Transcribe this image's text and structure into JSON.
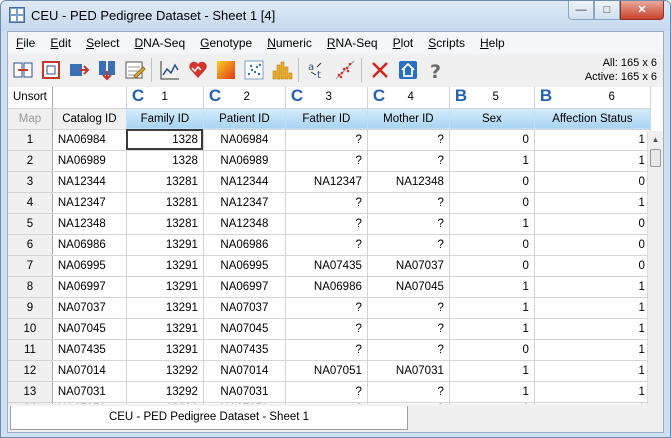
{
  "window": {
    "title": "CEU - PED Pedigree Dataset - Sheet 1 [4]",
    "minimize": "—",
    "maximize": "□",
    "close": "✕"
  },
  "menu": [
    {
      "first": "F",
      "rest": "ile"
    },
    {
      "first": "E",
      "rest": "dit"
    },
    {
      "first": "S",
      "rest": "elect"
    },
    {
      "first": "D",
      "rest": "NA-Seq"
    },
    {
      "first": "G",
      "rest": "enotype"
    },
    {
      "first": "N",
      "rest": "umeric"
    },
    {
      "first": "R",
      "rest": "NA-Seq"
    },
    {
      "first": "P",
      "rest": "lot"
    },
    {
      "first": "S",
      "rest": "cripts"
    },
    {
      "first": "H",
      "rest": "elp"
    }
  ],
  "toolbar_icons": [
    "split-columns-icon",
    "join-rows-icon",
    "move-right-icon",
    "move-down-icon",
    "edit-sheet-icon",
    "line-plot-icon",
    "heart-plot-icon",
    "heatmap-icon",
    "scatter-plot-icon",
    "histogram-icon",
    "text-format-icon",
    "linkage-plot-icon",
    "delete-icon",
    "home-icon",
    "help-icon"
  ],
  "dims": {
    "all": "All: 165 x 6",
    "active": "Active: 165 x 6"
  },
  "grid": {
    "unsort_label": "Unsort",
    "map_label": "Map",
    "catalog_header": "Catalog ID",
    "columns": [
      {
        "type": "C",
        "index": "1",
        "header": "Family ID"
      },
      {
        "type": "C",
        "index": "2",
        "header": "Patient ID"
      },
      {
        "type": "C",
        "index": "3",
        "header": "Father ID"
      },
      {
        "type": "C",
        "index": "4",
        "header": "Mother ID"
      },
      {
        "type": "B",
        "index": "5",
        "header": "Sex"
      },
      {
        "type": "B",
        "index": "6",
        "header": "Affection Status"
      }
    ],
    "rows": [
      [
        "1",
        "NA06984",
        "1328",
        "NA06984",
        "?",
        "?",
        "0",
        "1"
      ],
      [
        "2",
        "NA06989",
        "1328",
        "NA06989",
        "?",
        "?",
        "1",
        "1"
      ],
      [
        "3",
        "NA12344",
        "13281",
        "NA12344",
        "NA12347",
        "NA12348",
        "0",
        "0"
      ],
      [
        "4",
        "NA12347",
        "13281",
        "NA12347",
        "?",
        "?",
        "0",
        "1"
      ],
      [
        "5",
        "NA12348",
        "13281",
        "NA12348",
        "?",
        "?",
        "1",
        "0"
      ],
      [
        "6",
        "NA06986",
        "13291",
        "NA06986",
        "?",
        "?",
        "0",
        "0"
      ],
      [
        "7",
        "NA06995",
        "13291",
        "NA06995",
        "NA07435",
        "NA07037",
        "0",
        "0"
      ],
      [
        "8",
        "NA06997",
        "13291",
        "NA06997",
        "NA06986",
        "NA07045",
        "1",
        "1"
      ],
      [
        "9",
        "NA07037",
        "13291",
        "NA07037",
        "?",
        "?",
        "1",
        "1"
      ],
      [
        "10",
        "NA07045",
        "13291",
        "NA07045",
        "?",
        "?",
        "1",
        "1"
      ],
      [
        "11",
        "NA07435",
        "13291",
        "NA07435",
        "?",
        "?",
        "0",
        "1"
      ],
      [
        "12",
        "NA07014",
        "13292",
        "NA07014",
        "NA07051",
        "NA07031",
        "1",
        "1"
      ],
      [
        "13",
        "NA07031",
        "13292",
        "NA07031",
        "?",
        "?",
        "1",
        "1"
      ],
      [
        "14",
        "NA07051",
        "13292",
        "NA07051",
        "?",
        "?",
        "1",
        "1"
      ]
    ]
  },
  "sheet_tab": "CEU - PED Pedigree Dataset - Sheet 1"
}
